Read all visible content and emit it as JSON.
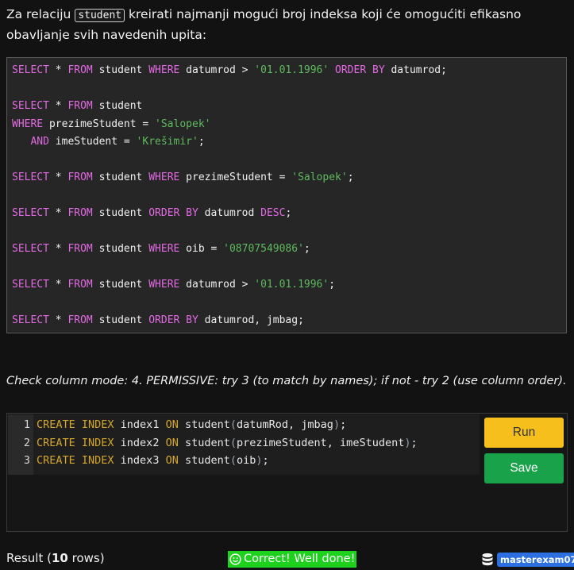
{
  "question": {
    "before": "Za relaciju ",
    "relation": "student",
    "after": " kreirati najmanji mogući broj indeksa koji će omogućiti efikasno obavljanje svih navedenih upita:"
  },
  "queries": [
    [
      {
        "t": "kw",
        "v": "SELECT"
      },
      {
        "t": "id",
        "v": " * "
      },
      {
        "t": "kw",
        "v": "FROM"
      },
      {
        "t": "id",
        "v": " student "
      },
      {
        "t": "kw",
        "v": "WHERE"
      },
      {
        "t": "id",
        "v": " datumrod > "
      },
      {
        "t": "str",
        "v": "'01.01.1996'"
      },
      {
        "t": "id",
        "v": " "
      },
      {
        "t": "kw",
        "v": "ORDER BY"
      },
      {
        "t": "id",
        "v": " datumrod;"
      }
    ],
    [],
    [
      {
        "t": "kw",
        "v": "SELECT"
      },
      {
        "t": "id",
        "v": " * "
      },
      {
        "t": "kw",
        "v": "FROM"
      },
      {
        "t": "id",
        "v": " student"
      }
    ],
    [
      {
        "t": "kw",
        "v": "WHERE"
      },
      {
        "t": "id",
        "v": " prezimeStudent = "
      },
      {
        "t": "str",
        "v": "'Salopek'"
      }
    ],
    [
      {
        "t": "id",
        "v": "   "
      },
      {
        "t": "kw",
        "v": "AND"
      },
      {
        "t": "id",
        "v": " imeStudent = "
      },
      {
        "t": "str",
        "v": "'Krešimir'"
      },
      {
        "t": "id",
        "v": ";"
      }
    ],
    [],
    [
      {
        "t": "kw",
        "v": "SELECT"
      },
      {
        "t": "id",
        "v": " * "
      },
      {
        "t": "kw",
        "v": "FROM"
      },
      {
        "t": "id",
        "v": " student "
      },
      {
        "t": "kw",
        "v": "WHERE"
      },
      {
        "t": "id",
        "v": " prezimeStudent = "
      },
      {
        "t": "str",
        "v": "'Salopek'"
      },
      {
        "t": "id",
        "v": ";"
      }
    ],
    [],
    [
      {
        "t": "kw",
        "v": "SELECT"
      },
      {
        "t": "id",
        "v": " * "
      },
      {
        "t": "kw",
        "v": "FROM"
      },
      {
        "t": "id",
        "v": " student "
      },
      {
        "t": "kw",
        "v": "ORDER BY"
      },
      {
        "t": "id",
        "v": " datumrod "
      },
      {
        "t": "kw",
        "v": "DESC"
      },
      {
        "t": "id",
        "v": ";"
      }
    ],
    [],
    [
      {
        "t": "kw",
        "v": "SELECT"
      },
      {
        "t": "id",
        "v": " * "
      },
      {
        "t": "kw",
        "v": "FROM"
      },
      {
        "t": "id",
        "v": " student "
      },
      {
        "t": "kw",
        "v": "WHERE"
      },
      {
        "t": "id",
        "v": " oib = "
      },
      {
        "t": "str",
        "v": "'08707549086'"
      },
      {
        "t": "id",
        "v": ";"
      }
    ],
    [],
    [
      {
        "t": "kw",
        "v": "SELECT"
      },
      {
        "t": "id",
        "v": " * "
      },
      {
        "t": "kw",
        "v": "FROM"
      },
      {
        "t": "id",
        "v": " student "
      },
      {
        "t": "kw",
        "v": "WHERE"
      },
      {
        "t": "id",
        "v": " datumrod > "
      },
      {
        "t": "str",
        "v": "'01.01.1996'"
      },
      {
        "t": "id",
        "v": ";"
      }
    ],
    [],
    [
      {
        "t": "kw",
        "v": "SELECT"
      },
      {
        "t": "id",
        "v": " * "
      },
      {
        "t": "kw",
        "v": "FROM"
      },
      {
        "t": "id",
        "v": " student "
      },
      {
        "t": "kw",
        "v": "ORDER BY"
      },
      {
        "t": "id",
        "v": " datumrod, jmbag;"
      }
    ]
  ],
  "check_mode": "Check column mode: 4. PERMISSIVE: try 3 (to match by names); if not - try 2 (use column order).",
  "editor": {
    "lines": [
      {
        "num": "1",
        "tokens": [
          {
            "t": "ck",
            "v": "CREATE INDEX"
          },
          {
            "t": "cid",
            "v": " index1 "
          },
          {
            "t": "ck",
            "v": "ON"
          },
          {
            "t": "cid",
            "v": " student"
          },
          {
            "t": "paren",
            "v": "("
          },
          {
            "t": "cid",
            "v": "datumRod, jmbag"
          },
          {
            "t": "paren",
            "v": ")"
          },
          {
            "t": "cid",
            "v": ";"
          }
        ]
      },
      {
        "num": "2",
        "tokens": [
          {
            "t": "ck",
            "v": "CREATE INDEX"
          },
          {
            "t": "cid",
            "v": " index2 "
          },
          {
            "t": "ck",
            "v": "ON"
          },
          {
            "t": "cid",
            "v": " student"
          },
          {
            "t": "paren",
            "v": "("
          },
          {
            "t": "cid",
            "v": "prezimeStudent, imeStudent"
          },
          {
            "t": "paren",
            "v": ")"
          },
          {
            "t": "cid",
            "v": ";"
          }
        ]
      },
      {
        "num": "3",
        "tokens": [
          {
            "t": "ck",
            "v": "CREATE INDEX"
          },
          {
            "t": "cid",
            "v": " index3 "
          },
          {
            "t": "ck",
            "v": "ON"
          },
          {
            "t": "cid",
            "v": " student"
          },
          {
            "t": "paren",
            "v": "("
          },
          {
            "t": "cid",
            "v": "oib"
          },
          {
            "t": "paren",
            "v": ")"
          },
          {
            "t": "cid",
            "v": ";"
          }
        ]
      }
    ]
  },
  "buttons": {
    "run": "Run",
    "save": "Save"
  },
  "footer": {
    "result_prefix": "Result (",
    "row_count": "10",
    "result_suffix": " rows)",
    "status": "Correct! Well done!",
    "username": "masterexam07"
  },
  "colors": {
    "run": "#f6bf1c",
    "save": "#19a24a",
    "status": "#1fd11f",
    "user_badge": "#2b6fe0"
  }
}
